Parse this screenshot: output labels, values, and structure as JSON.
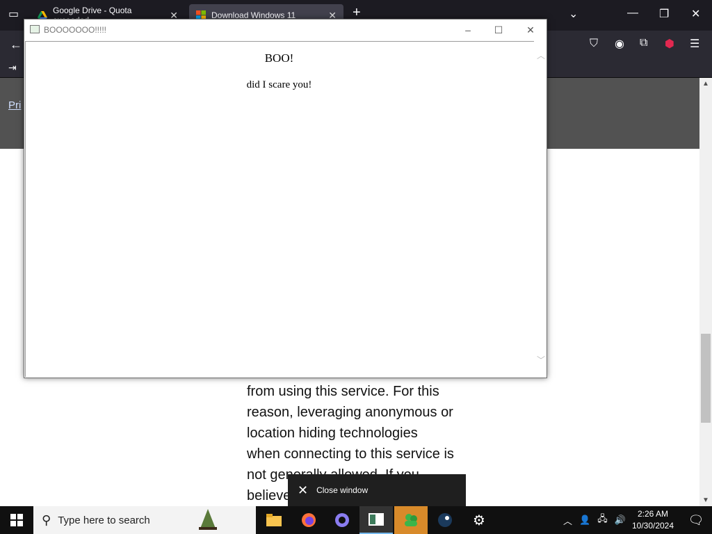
{
  "browser": {
    "tabs": [
      {
        "label": "Google Drive - Quota exceeded",
        "icon": "google-drive-icon"
      },
      {
        "label": "Download Windows 11",
        "icon": "windows-logo-icon"
      }
    ],
    "new_tab": "+",
    "banner_link": "Pri"
  },
  "page": {
    "text_lines": [
      "from using this service. For this",
      "reason, leveraging anonymous or",
      "location hiding technologies",
      "when connecting to this service is",
      "not generally allowed. If you",
      "believe"
    ]
  },
  "popup": {
    "title": "BOOOOOOO!!!!!",
    "heading": "BOO!",
    "message": "did I scare you!",
    "minimize": "–",
    "maximize": "☐",
    "close": "✕"
  },
  "tooltip": {
    "label": "Close window"
  },
  "taskbar": {
    "search_placeholder": "Type here to search",
    "time": "2:26 AM",
    "date": "10/30/2024"
  },
  "colors": {
    "taskbar_bg": "#101010",
    "browser_bg": "#1c1b22",
    "banner_bg": "#525252",
    "active_app_accent": "#76b9ed"
  }
}
